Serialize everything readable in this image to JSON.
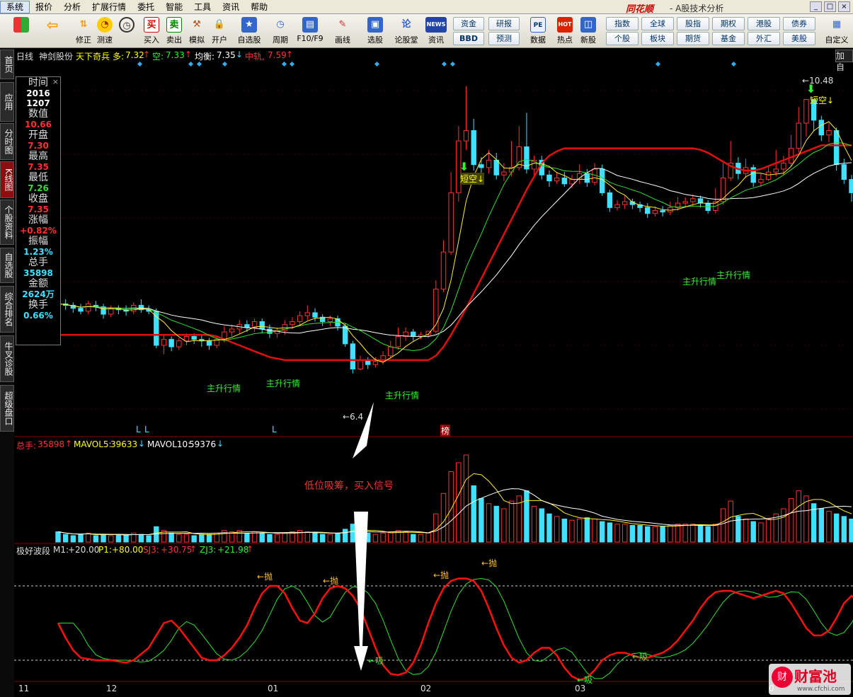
{
  "menu": [
    "系统",
    "报价",
    "分析",
    "扩展行情",
    "委托",
    "智能",
    "工具",
    "资讯",
    "帮助"
  ],
  "brand": "同花顺",
  "brand_sub": "- A股技术分析",
  "toolbar": {
    "icons": [
      "修正",
      "测速",
      "买入",
      "卖出",
      "模拟",
      "开户",
      "自选股",
      "周期",
      "F10/F9",
      "画线",
      "选股",
      "论股堂",
      "资讯",
      "数据",
      "热点",
      "新股",
      "自定义"
    ],
    "buttons": [
      "资金",
      "研报",
      "BBD",
      "预测",
      "指数",
      "全球",
      "股指",
      "期权",
      "港股",
      "债券",
      "个股",
      "板块",
      "期货",
      "基金",
      "外汇",
      "美股"
    ],
    "buy_char": "买",
    "sell_char": "卖",
    "news_char": "NEWS",
    "pe_char": "PE",
    "hot_char": "HOT"
  },
  "sidetabs": [
    "首页",
    "应用",
    "分时图",
    "K线图",
    "个股资料",
    "自选股",
    "综合排名",
    "牛叉诊股",
    "超级盘口"
  ],
  "header": {
    "period": "日线",
    "stock": "神剑股份",
    "indicator": "天下奇兵",
    "duo_label": "多:",
    "duo": "7.32",
    "kong_label": "空:",
    "kong": "7.33",
    "jun_label": "均衡:",
    "jun": "7.35",
    "zhong_label": "中轨,",
    "zhong": "7.59",
    "add": "加自"
  },
  "info": [
    {
      "k": "时间",
      "v": "2016",
      "v2": "1207",
      "c": "#fff"
    },
    {
      "k": "数值",
      "v": "10.66",
      "c": "#ff3030"
    },
    {
      "k": "开盘",
      "v": "7.30",
      "c": "#ff3030"
    },
    {
      "k": "最高",
      "v": "7.35",
      "c": "#ff3030"
    },
    {
      "k": "最低",
      "v": "7.26",
      "c": "#30e030"
    },
    {
      "k": "收盘",
      "v": "7.35",
      "c": "#ff3030"
    },
    {
      "k": "涨幅",
      "v": "+0.82%",
      "c": "#ff3030"
    },
    {
      "k": "振幅",
      "v": "1.23%",
      "c": "#40e0ff"
    },
    {
      "k": "总手",
      "v": "35898",
      "c": "#40e0ff"
    },
    {
      "k": "金额",
      "v": "2624万",
      "c": "#40e0ff"
    },
    {
      "k": "换手",
      "v": "0.66%",
      "c": "#40e0ff"
    }
  ],
  "price_labels": {
    "low": "6.4",
    "high": "10.48"
  },
  "signals": {
    "main_up": "主升行情",
    "short_kong": "短空",
    "bang": "榜",
    "L": "L",
    "xi": "吸",
    "pao": "抛"
  },
  "vol_header": {
    "label": "总手:",
    "val": "35898",
    "ma5_label": "MAVOL5:",
    "ma5": "39633",
    "ma10_label": "MAVOL10:",
    "ma10": "59376"
  },
  "osc_header": {
    "name": "极好波段",
    "m1_label": "M1:",
    "m1": "+20.00",
    "p1_label": "P1:",
    "p1": "+80.00",
    "sj3_label": "SJ3:",
    "sj3": "+30.75",
    "zj3_label": "ZJ3:",
    "zj3": "+21.98"
  },
  "annotation": "低位吸筹，买入信号",
  "xaxis": [
    "11",
    "12",
    "01",
    "02",
    "03",
    "0"
  ],
  "watermark": {
    "name": "财富池",
    "url": "www.cfchi.com",
    "logo": "财"
  },
  "chart_data": {
    "type": "candlestick",
    "candles": [
      [
        7.78,
        7.72,
        7.85,
        7.65
      ],
      [
        7.72,
        7.7,
        7.78,
        7.64
      ],
      [
        7.7,
        7.66,
        7.74,
        7.6
      ],
      [
        7.66,
        7.62,
        7.72,
        7.58
      ],
      [
        7.62,
        7.72,
        7.76,
        7.58
      ],
      [
        7.7,
        7.68,
        7.76,
        7.62
      ],
      [
        7.68,
        7.58,
        7.72,
        7.52
      ],
      [
        7.58,
        7.66,
        7.7,
        7.54
      ],
      [
        7.66,
        7.64,
        7.7,
        7.58
      ],
      [
        7.64,
        7.62,
        7.7,
        7.56
      ],
      [
        7.62,
        7.7,
        7.74,
        7.58
      ],
      [
        7.7,
        7.64,
        7.78,
        7.6
      ],
      [
        7.64,
        7.62,
        7.7,
        7.58
      ],
      [
        7.62,
        7.16,
        7.66,
        7.12
      ],
      [
        7.16,
        7.24,
        7.3,
        7.04
      ],
      [
        7.24,
        7.14,
        7.28,
        7.08
      ],
      [
        7.14,
        7.22,
        7.26,
        7.1
      ],
      [
        7.22,
        7.28,
        7.32,
        7.16
      ],
      [
        7.28,
        7.24,
        7.32,
        7.18
      ],
      [
        7.24,
        7.22,
        7.3,
        7.14
      ],
      [
        7.22,
        7.16,
        7.26,
        7.1
      ],
      [
        7.16,
        7.24,
        7.28,
        7.12
      ],
      [
        7.24,
        7.34,
        7.42,
        7.2
      ],
      [
        7.34,
        7.38,
        7.44,
        7.28
      ],
      [
        7.38,
        7.44,
        7.5,
        7.32
      ],
      [
        7.44,
        7.4,
        7.5,
        7.34
      ],
      [
        7.4,
        7.48,
        7.52,
        7.34
      ],
      [
        7.48,
        7.38,
        7.52,
        7.32
      ],
      [
        7.38,
        7.32,
        7.44,
        7.26
      ],
      [
        7.32,
        7.36,
        7.4,
        7.26
      ],
      [
        7.36,
        7.44,
        7.5,
        7.3
      ],
      [
        7.44,
        7.48,
        7.54,
        7.38
      ],
      [
        7.48,
        7.56,
        7.62,
        7.42
      ],
      [
        7.56,
        7.6,
        7.7,
        7.5
      ],
      [
        7.6,
        7.54,
        7.66,
        7.48
      ],
      [
        7.54,
        7.48,
        7.58,
        7.42
      ],
      [
        7.48,
        7.52,
        7.56,
        7.42
      ],
      [
        7.52,
        7.42,
        7.56,
        7.36
      ],
      [
        7.42,
        7.18,
        7.46,
        7.14
      ],
      [
        7.18,
        6.84,
        7.22,
        6.78
      ],
      [
        6.84,
        6.96,
        7.02,
        6.82
      ],
      [
        6.96,
        6.9,
        7.0,
        6.84
      ],
      [
        6.9,
        6.94,
        7.0,
        6.86
      ],
      [
        6.94,
        7.02,
        7.08,
        6.9
      ],
      [
        7.02,
        7.14,
        7.22,
        6.98
      ],
      [
        7.14,
        7.28,
        7.4,
        7.1
      ],
      [
        7.28,
        7.34,
        7.4,
        7.22
      ],
      [
        7.34,
        7.28,
        7.38,
        7.22
      ],
      [
        7.28,
        7.3,
        7.34,
        7.24
      ],
      [
        7.3,
        7.35,
        7.35,
        7.26
      ],
      [
        7.35,
        7.92,
        8.04,
        7.32
      ],
      [
        7.92,
        8.42,
        8.58,
        7.88
      ],
      [
        8.42,
        9.22,
        9.5,
        8.38
      ],
      [
        9.22,
        9.92,
        10.12,
        9.1
      ],
      [
        9.92,
        10.06,
        10.66,
        9.8
      ],
      [
        10.06,
        9.6,
        10.22,
        9.52
      ],
      [
        9.6,
        9.56,
        9.7,
        9.42
      ],
      [
        9.56,
        9.66,
        9.8,
        9.48
      ],
      [
        9.66,
        9.46,
        9.76,
        9.4
      ],
      [
        9.46,
        9.5,
        9.62,
        9.38
      ],
      [
        9.5,
        9.56,
        9.92,
        9.44
      ],
      [
        9.56,
        9.84,
        10.12,
        9.52
      ],
      [
        9.84,
        9.54,
        10.3,
        9.48
      ],
      [
        9.54,
        9.66,
        9.72,
        9.46
      ],
      [
        9.66,
        9.46,
        9.72,
        9.4
      ],
      [
        9.46,
        9.38,
        9.52,
        9.3
      ],
      [
        9.38,
        9.42,
        9.5,
        9.34
      ],
      [
        9.42,
        9.34,
        9.5,
        9.3
      ],
      [
        9.34,
        9.4,
        9.46,
        9.28
      ],
      [
        9.4,
        9.48,
        9.6,
        9.34
      ],
      [
        9.48,
        9.36,
        9.54,
        9.3
      ],
      [
        9.36,
        9.54,
        9.62,
        9.32
      ],
      [
        9.54,
        9.22,
        9.6,
        9.18
      ],
      [
        9.22,
        9.02,
        9.26,
        8.96
      ],
      [
        9.02,
        9.06,
        9.12,
        8.98
      ],
      [
        9.06,
        9.1,
        9.18,
        9.0
      ],
      [
        9.1,
        9.06,
        9.14,
        9.0
      ],
      [
        9.06,
        9.02,
        9.1,
        8.96
      ],
      [
        9.02,
        8.94,
        9.08,
        8.88
      ],
      [
        8.94,
        8.98,
        9.04,
        8.9
      ],
      [
        8.98,
        8.96,
        9.04,
        8.9
      ],
      [
        8.96,
        9.02,
        9.1,
        8.92
      ],
      [
        9.02,
        9.08,
        9.16,
        8.98
      ],
      [
        9.08,
        9.1,
        9.16,
        9.02
      ],
      [
        9.1,
        9.14,
        9.2,
        9.04
      ],
      [
        9.14,
        9.08,
        9.18,
        9.02
      ],
      [
        9.08,
        8.98,
        9.12,
        8.94
      ],
      [
        8.98,
        9.1,
        9.28,
        8.94
      ],
      [
        9.1,
        9.42,
        9.62,
        9.06
      ],
      [
        9.42,
        9.62,
        9.92,
        9.38
      ],
      [
        9.62,
        9.48,
        9.7,
        9.4
      ],
      [
        9.48,
        9.56,
        9.68,
        9.42
      ],
      [
        9.56,
        9.36,
        9.6,
        9.3
      ],
      [
        9.36,
        9.4,
        9.48,
        9.3
      ],
      [
        9.4,
        9.5,
        9.58,
        9.38
      ],
      [
        9.5,
        9.54,
        9.8,
        9.44
      ],
      [
        9.54,
        9.62,
        9.72,
        9.46
      ],
      [
        9.62,
        9.82,
        10.0,
        9.58
      ],
      [
        9.82,
        10.16,
        10.38,
        9.76
      ],
      [
        10.16,
        10.48,
        10.48,
        9.98
      ],
      [
        10.48,
        10.2,
        10.44,
        10.06
      ],
      [
        10.2,
        10.0,
        10.26,
        9.92
      ],
      [
        10.0,
        10.06,
        10.16,
        9.9
      ],
      [
        10.06,
        9.6,
        10.1,
        9.52
      ],
      [
        9.6,
        9.4,
        9.68,
        9.34
      ],
      [
        9.4,
        9.22,
        9.46,
        9.1
      ]
    ],
    "ylim": [
      6.3,
      10.6
    ],
    "mid_band": [
      7.3,
      7.3,
      7.3,
      7.3,
      7.3,
      7.3,
      7.3,
      7.3,
      7.3,
      7.3,
      7.3,
      7.3,
      7.3,
      7.3,
      7.3,
      7.3,
      7.3,
      7.3,
      7.3,
      7.3,
      7.3,
      7.28,
      7.24,
      7.2,
      7.16,
      7.12,
      7.08,
      7.04,
      7.0,
      6.98,
      6.96,
      6.96,
      6.96,
      6.96,
      6.96,
      6.96,
      6.96,
      6.96,
      6.96,
      6.96,
      6.96,
      6.96,
      6.96,
      6.96,
      6.96,
      6.96,
      6.96,
      6.96,
      6.96,
      6.96,
      7.02,
      7.14,
      7.3,
      7.48,
      7.66,
      7.86,
      8.06,
      8.26,
      8.46,
      8.66,
      8.86,
      9.06,
      9.26,
      9.44,
      9.62,
      9.72,
      9.78,
      9.82,
      9.82,
      9.82,
      9.82,
      9.82,
      9.82,
      9.82,
      9.82,
      9.82,
      9.82,
      9.82,
      9.82,
      9.82,
      9.82,
      9.82,
      9.82,
      9.82,
      9.82,
      9.8,
      9.76,
      9.7,
      9.64,
      9.58,
      9.54,
      9.52,
      9.52,
      9.54,
      9.58,
      9.62,
      9.66,
      9.7,
      9.74,
      9.78,
      9.82,
      9.86,
      9.86,
      9.86,
      9.86,
      9.86
    ],
    "volume": [
      8,
      6,
      5,
      6,
      7,
      5,
      6,
      5,
      6,
      5,
      7,
      6,
      5,
      12,
      9,
      7,
      6,
      6,
      5,
      6,
      6,
      7,
      9,
      8,
      9,
      7,
      8,
      7,
      6,
      6,
      7,
      8,
      9,
      8,
      7,
      6,
      6,
      7,
      10,
      14,
      8,
      7,
      6,
      7,
      8,
      9,
      8,
      6,
      6,
      7,
      22,
      38,
      55,
      62,
      68,
      44,
      34,
      30,
      28,
      26,
      32,
      36,
      40,
      28,
      26,
      22,
      20,
      18,
      17,
      18,
      19,
      18,
      16,
      15,
      14,
      14,
      13,
      13,
      12,
      12,
      12,
      13,
      14,
      14,
      14,
      13,
      12,
      14,
      26,
      32,
      20,
      18,
      16,
      15,
      18,
      22,
      26,
      34,
      40,
      36,
      30,
      26,
      24,
      22,
      20,
      18
    ],
    "oscillator_red": [
      50,
      38,
      28,
      22,
      21,
      20,
      20,
      20,
      19,
      18,
      20,
      25,
      30,
      40,
      50,
      52,
      46,
      38,
      30,
      22,
      20,
      20,
      24,
      30,
      38,
      48,
      62,
      74,
      80,
      80,
      74,
      62,
      52,
      50,
      58,
      70,
      78,
      80,
      78,
      72,
      62,
      46,
      30,
      16,
      9,
      8,
      10,
      18,
      32,
      50,
      66,
      78,
      84,
      86,
      86,
      84,
      76,
      62,
      46,
      32,
      22,
      18,
      20,
      26,
      30,
      30,
      24,
      14,
      7,
      4,
      6,
      12,
      20,
      24,
      26,
      26,
      24,
      22,
      22,
      24,
      26,
      30,
      36,
      44,
      52,
      62,
      70,
      75,
      76,
      76,
      74,
      72,
      70,
      72,
      74,
      76,
      74,
      66,
      56,
      46,
      40,
      40,
      44,
      54,
      66,
      72,
      66,
      52,
      40,
      30
    ]
  }
}
